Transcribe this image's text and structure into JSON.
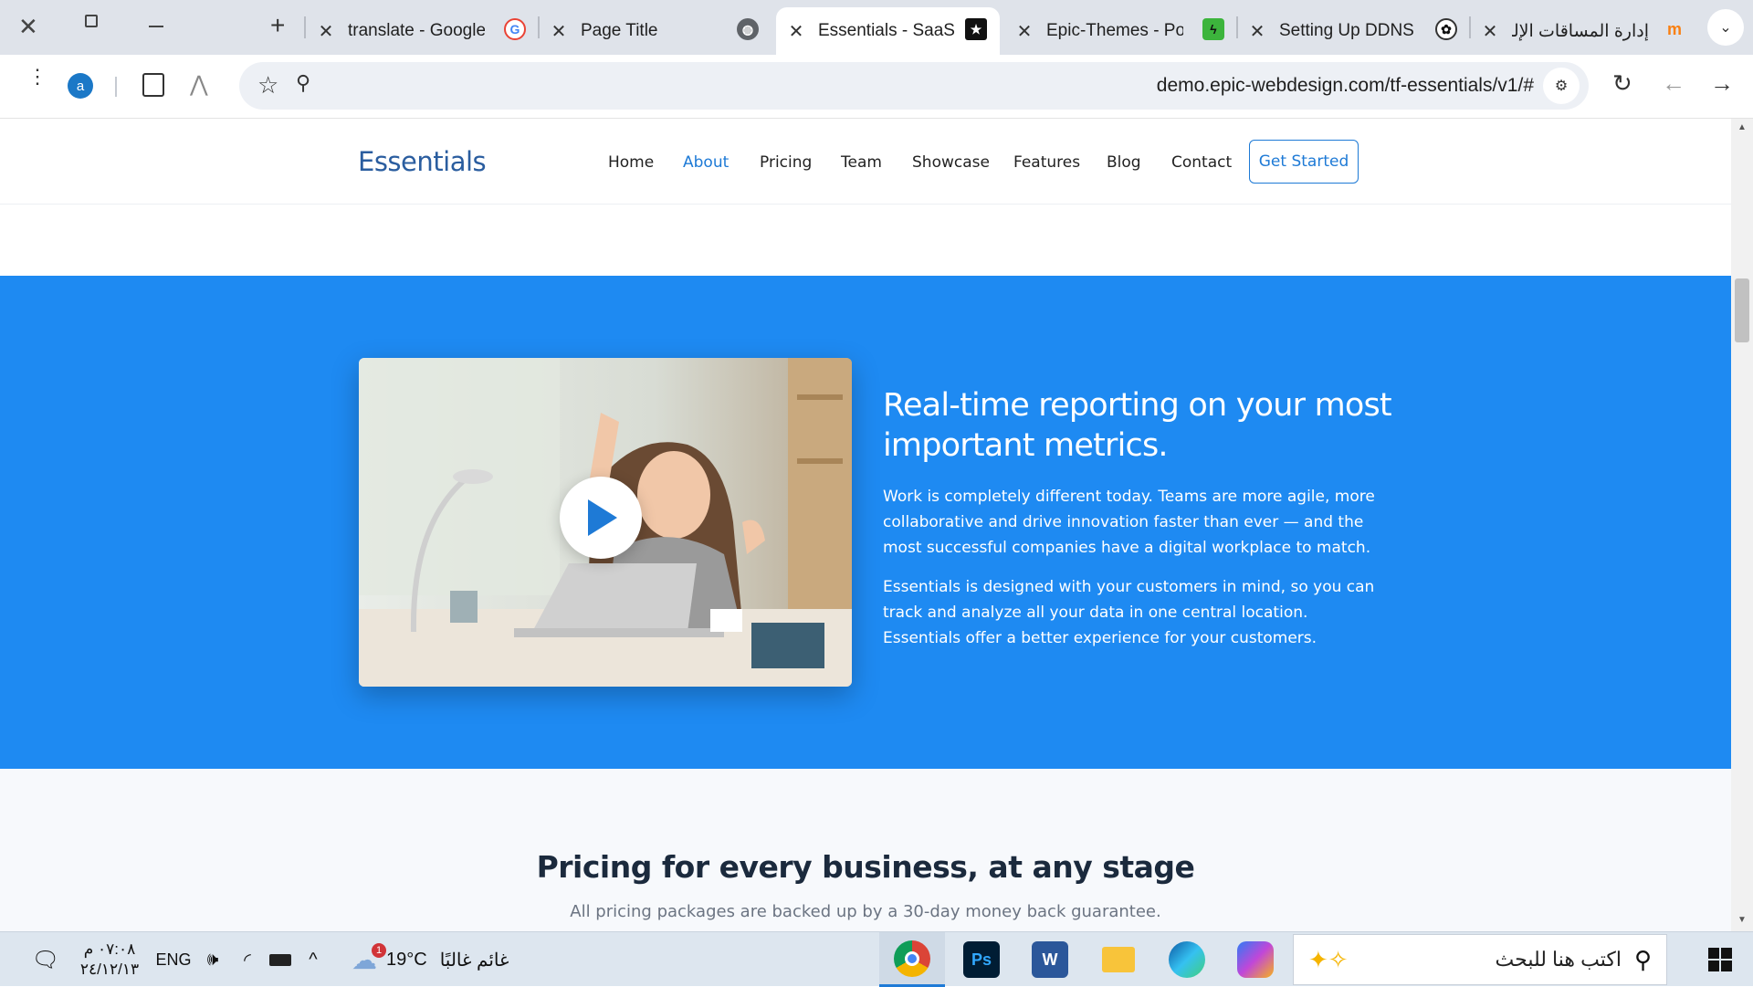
{
  "browser": {
    "tabs": [
      {
        "title": "translate - Google",
        "icon": "google-icon",
        "active": false
      },
      {
        "title": "Page Title",
        "icon": "globe-icon",
        "active": false
      },
      {
        "title": "Essentials - SaaS La",
        "icon": "star-icon",
        "active": true
      },
      {
        "title": "Epic-Themes - Port",
        "icon": "bolt-icon",
        "active": false
      },
      {
        "title": "Setting Up DDNS",
        "icon": "openai-icon",
        "active": false
      },
      {
        "title": "إدارة المساقات الإلك",
        "icon": "moodle-icon",
        "active": false
      }
    ],
    "url": "demo.epic-webdesign.com/tf-essentials/v1/#",
    "profile_initial": "a"
  },
  "site": {
    "logo": "Essentials",
    "nav": [
      "Home",
      "About",
      "Pricing",
      "Team",
      "Showcase",
      "Features",
      "Blog",
      "Contact"
    ],
    "active_nav": "About",
    "cta": "Get Started",
    "hero": {
      "title": "Real-time reporting on your most important metrics.",
      "paragraph1": "Work is completely different today. Teams are more agile, more collaborative and drive innovation faster than ever — and the most successful companies have a digital workplace to match.",
      "paragraph2": "Essentials is designed with your customers in mind, so you can track and analyze all your data in one central location. Essentials offer a better experience for your customers."
    },
    "pricing": {
      "title": "Pricing for every business, at any stage",
      "subtitle": "All pricing packages are backed up by a 30-day money back guarantee."
    },
    "colors": {
      "accent": "#1e8af2",
      "brand": "#2a5d9f"
    }
  },
  "taskbar": {
    "time": "٠٧:٠٨ م",
    "date": "٢٤/١٢/١٣",
    "language": "ENG",
    "weather_temp": "19°C",
    "weather_text": "غائم غالبًا",
    "weather_badge": "1",
    "search_placeholder": "اكتب هنا للبحث"
  }
}
